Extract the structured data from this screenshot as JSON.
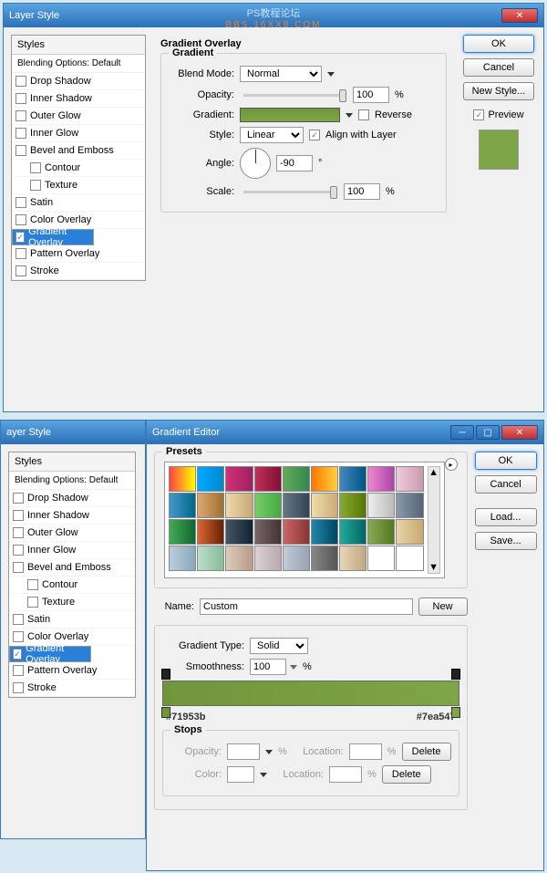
{
  "watermark": {
    "line1": "PS教程论坛",
    "line2": "BBS.16XX8.COM"
  },
  "win1": {
    "title": "Layer Style",
    "styles_hdr": "Styles",
    "blending": "Blending Options: Default",
    "items": [
      {
        "label": "Drop Shadow",
        "chk": false
      },
      {
        "label": "Inner Shadow",
        "chk": false
      },
      {
        "label": "Outer Glow",
        "chk": false
      },
      {
        "label": "Inner Glow",
        "chk": false
      },
      {
        "label": "Bevel and Emboss",
        "chk": false
      },
      {
        "label": "Contour",
        "chk": false,
        "indent": true
      },
      {
        "label": "Texture",
        "chk": false,
        "indent": true
      },
      {
        "label": "Satin",
        "chk": false
      },
      {
        "label": "Color Overlay",
        "chk": false
      },
      {
        "label": "Gradient Overlay",
        "chk": true,
        "sel": true
      },
      {
        "label": "Pattern Overlay",
        "chk": false
      },
      {
        "label": "Stroke",
        "chk": false
      }
    ],
    "panel_title": "Gradient Overlay",
    "grp_title": "Gradient",
    "blend_mode": {
      "lbl": "Blend Mode:",
      "val": "Normal"
    },
    "opacity": {
      "lbl": "Opacity:",
      "val": "100",
      "unit": "%"
    },
    "gradient": {
      "lbl": "Gradient:",
      "reverse": "Reverse"
    },
    "style": {
      "lbl": "Style:",
      "val": "Linear",
      "align": "Align with Layer"
    },
    "angle": {
      "lbl": "Angle:",
      "val": "-90",
      "unit": "°"
    },
    "scale": {
      "lbl": "Scale:",
      "val": "100",
      "unit": "%"
    },
    "btns": {
      "ok": "OK",
      "cancel": "Cancel",
      "newstyle": "New Style...",
      "preview": "Preview"
    }
  },
  "win2_left": {
    "title": "ayer Style"
  },
  "win2": {
    "title": "Gradient Editor",
    "presets_lbl": "Presets",
    "swatches": [
      "linear-gradient(90deg,#f44,#ff0)",
      "linear-gradient(90deg,#0af,#08c)",
      "linear-gradient(90deg,#d0307a,#a02060)",
      "linear-gradient(90deg,#c0305a,#801038)",
      "linear-gradient(90deg,#6a5,#385)",
      "linear-gradient(90deg,#f70,#ffd040)",
      "linear-gradient(90deg,#48b,#058)",
      "linear-gradient(90deg,#e8c,#a4a)",
      "linear-gradient(90deg,#ecd,#c9a)",
      "linear-gradient(90deg,#49c,#068)",
      "linear-gradient(90deg,#dca870,#a07030)",
      "linear-gradient(90deg,#eed8b0,#c8a870)",
      "linear-gradient(90deg,#7c6,#4a4)",
      "linear-gradient(90deg,#678,#345)",
      "linear-gradient(90deg,#eda,#ca7)",
      "linear-gradient(90deg,#8a3,#570)",
      "linear-gradient(90deg,#eee,#bbb)",
      "linear-gradient(90deg,#89a,#567)",
      "linear-gradient(90deg,#4a5,#163)",
      "linear-gradient(90deg,#d63,#620)",
      "linear-gradient(90deg,#456,#123)",
      "linear-gradient(90deg,#766,#433)",
      "linear-gradient(90deg,#c66,#833)",
      "linear-gradient(90deg,#28a,#046)",
      "linear-gradient(90deg,#2a9,#066)",
      "linear-gradient(90deg,#8a5,#572)",
      "linear-gradient(90deg,#e8d4a8,#c8a870)",
      "linear-gradient(90deg,#bcd,#8ab)",
      "linear-gradient(90deg,#bdc,#8b9)",
      "linear-gradient(90deg,#dcb,#b98)",
      "linear-gradient(90deg,#dcd0d4,#b8a8ac)",
      "linear-gradient(90deg,#c0cad8,#98a4b4)",
      "linear-gradient(90deg,#888,#555)",
      "linear-gradient(90deg,#e8d4b8,#c0a880)",
      "linear-gradient(90deg,#fff,#fff)",
      "linear-gradient(90deg,#fff,#fff)"
    ],
    "name": {
      "lbl": "Name:",
      "val": "Custom"
    },
    "gtype": {
      "lbl": "Gradient Type:",
      "val": "Solid"
    },
    "smooth": {
      "lbl": "Smoothness:",
      "val": "100",
      "unit": "%"
    },
    "hex_left": "#71953b",
    "hex_right": "#7ea547",
    "stops_lbl": "Stops",
    "stops": {
      "opacity": "Opacity:",
      "location": "Location:",
      "color": "Color:",
      "delete": "Delete",
      "pct": "%"
    },
    "btns": {
      "ok": "OK",
      "cancel": "Cancel",
      "load": "Load...",
      "save": "Save...",
      "new": "New"
    }
  }
}
